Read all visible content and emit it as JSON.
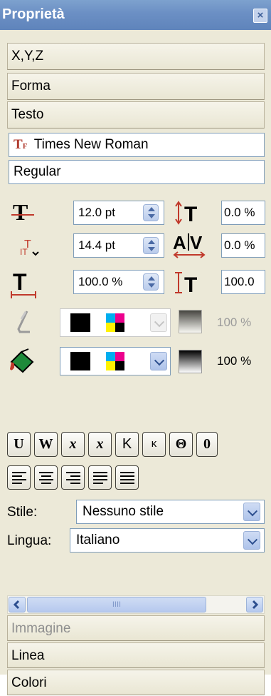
{
  "panel": {
    "title": "Proprietà",
    "close_glyph": "×"
  },
  "sections": {
    "xyz": "X,Y,Z",
    "forma": "Forma",
    "testo": "Testo",
    "immagine": "Immagine",
    "linea": "Linea",
    "colori": "Colori"
  },
  "font": {
    "family": "Times New Roman",
    "family_icon_text": "TF",
    "style": "Regular"
  },
  "metrics": {
    "font_size": "12.0 pt",
    "line_spacing": "14.4 pt",
    "scale_width": "100.0 %",
    "baseline_offset": "0.0 %",
    "tracking": "0.0 %",
    "scale_height": "100.0"
  },
  "colors": {
    "stroke_opacity": "100 %",
    "fill_opacity": "100 %"
  },
  "effects": {
    "buttons": [
      "U",
      "W",
      "x",
      "x",
      "K",
      "ĸ",
      "Θ",
      "0"
    ]
  },
  "style": {
    "label": "Stile:",
    "value": "Nessuno stile"
  },
  "language": {
    "label": "Lingua:",
    "value": "Italiano"
  },
  "scrollbar": {
    "grip_text": "IIII"
  },
  "icons": {
    "close": "close-icon",
    "font_type": "font-type-icon",
    "font_size": "font-size-icon",
    "line_spacing": "line-spacing-icon",
    "scale_width": "scale-width-icon",
    "baseline": "baseline-icon",
    "tracking": "tracking-icon",
    "scale_height": "scale-height-icon",
    "stroke": "pen-icon",
    "fill": "paint-bucket-icon"
  },
  "accent": {
    "titlebar": "#6b8fc4",
    "icon_red": "#c0392b"
  }
}
